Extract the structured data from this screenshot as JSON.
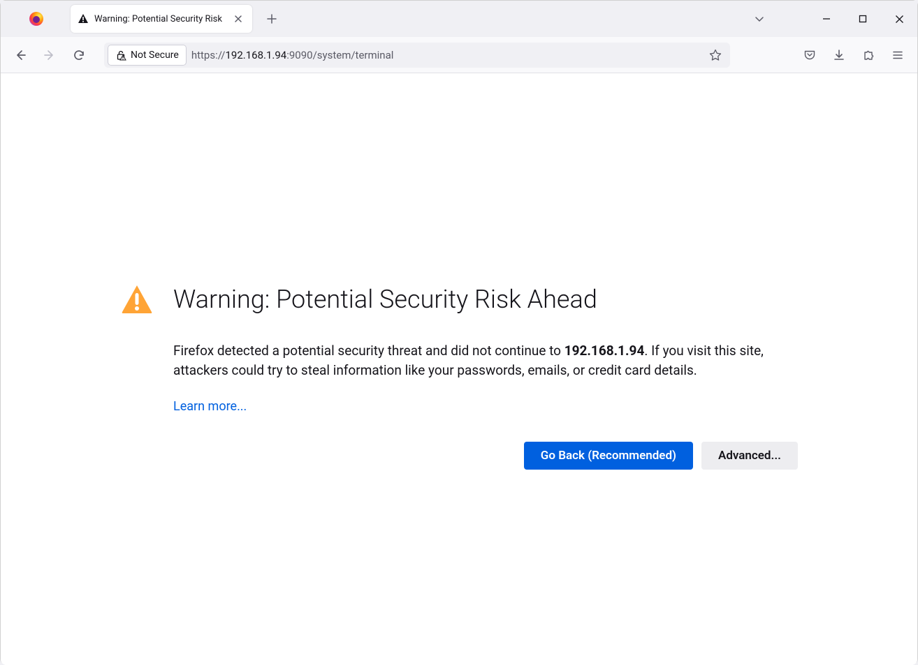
{
  "tabStrip": {
    "activeTab": {
      "title": "Warning: Potential Security Risk"
    }
  },
  "urlBar": {
    "securityBadge": "Not Secure",
    "url_protocol": "https://",
    "url_host": "192.168.1.94",
    "url_path": ":9090/system/terminal"
  },
  "page": {
    "title": "Warning: Potential Security Risk Ahead",
    "body_pre": "Firefox detected a potential security threat and did not continue to ",
    "body_host": "192.168.1.94",
    "body_post": ". If you visit this site, attackers could try to steal information like your passwords, emails, or credit card details.",
    "learn_more": "Learn more...",
    "go_back": "Go Back (Recommended)",
    "advanced": "Advanced..."
  }
}
